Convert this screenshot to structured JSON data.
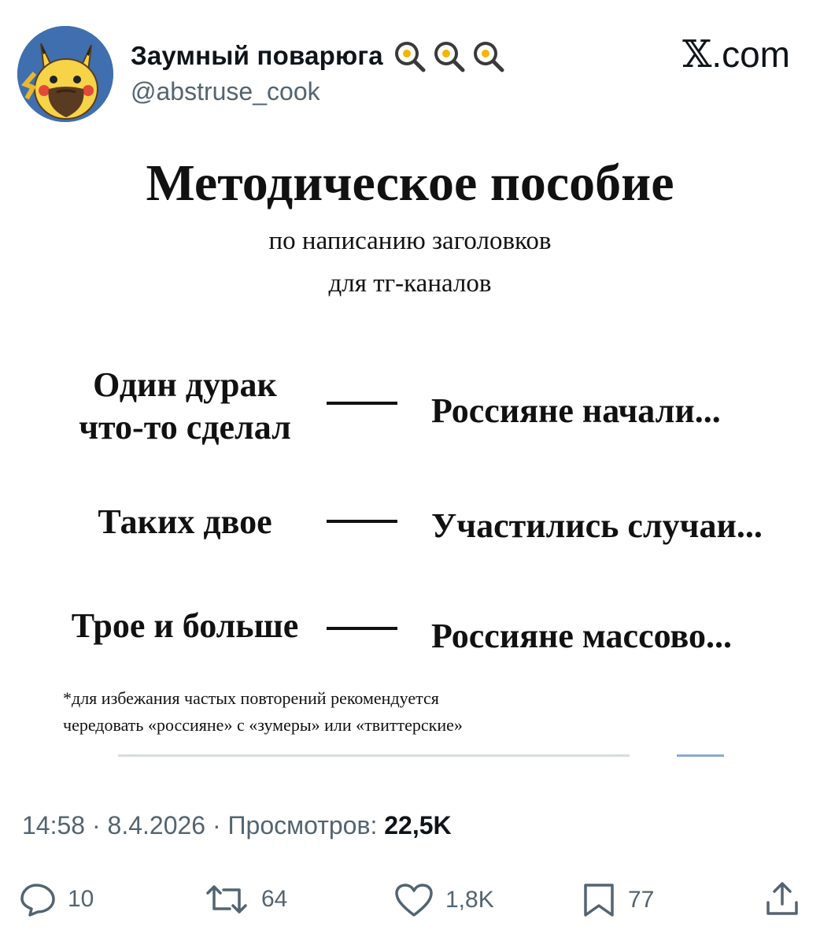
{
  "account": {
    "display_name": "Заумный поварюга",
    "handle": "@abstruse_cook",
    "name_emoji": "frying-pan-egg-icon",
    "name_emoji_count": 3,
    "avatar": "pikachu-with-beard-avatar"
  },
  "brand": {
    "mark": "𝕏",
    "suffix": ".com"
  },
  "meme": {
    "title": "Методическое пособие",
    "subtitle_lines": [
      "по написанию заголовков",
      "для тг-каналов"
    ],
    "rows": [
      {
        "left_lines": [
          "Один дурак",
          "что-то сделал"
        ],
        "right": "Россияне начали..."
      },
      {
        "left_lines": [
          "Таких двое"
        ],
        "right": "Участились случаи..."
      },
      {
        "left_lines": [
          "Трое и больше"
        ],
        "right": "Россияне массово..."
      }
    ],
    "footnote_lines": [
      "*для избежания частых повторений рекомендуется",
      "чередовать «россияне» с «зумеры» или «твиттерские»"
    ]
  },
  "meta": {
    "time": "14:58",
    "separator": " · ",
    "date": "8.4.2026",
    "views_label": "Просмотров: ",
    "views_count": "22,5K"
  },
  "actions": {
    "replies": {
      "icon": "reply-icon",
      "count": "10"
    },
    "reposts": {
      "icon": "repost-icon",
      "count": "64"
    },
    "likes": {
      "icon": "heart-icon",
      "count": "1,8K"
    },
    "bookmarks": {
      "icon": "bookmark-icon",
      "count": "77"
    },
    "share": {
      "icon": "share-icon"
    }
  },
  "colors": {
    "text": "#0f1419",
    "secondary": "#536471",
    "avatar_bg": "#3f6fae",
    "pikachu": "#f6d347"
  }
}
